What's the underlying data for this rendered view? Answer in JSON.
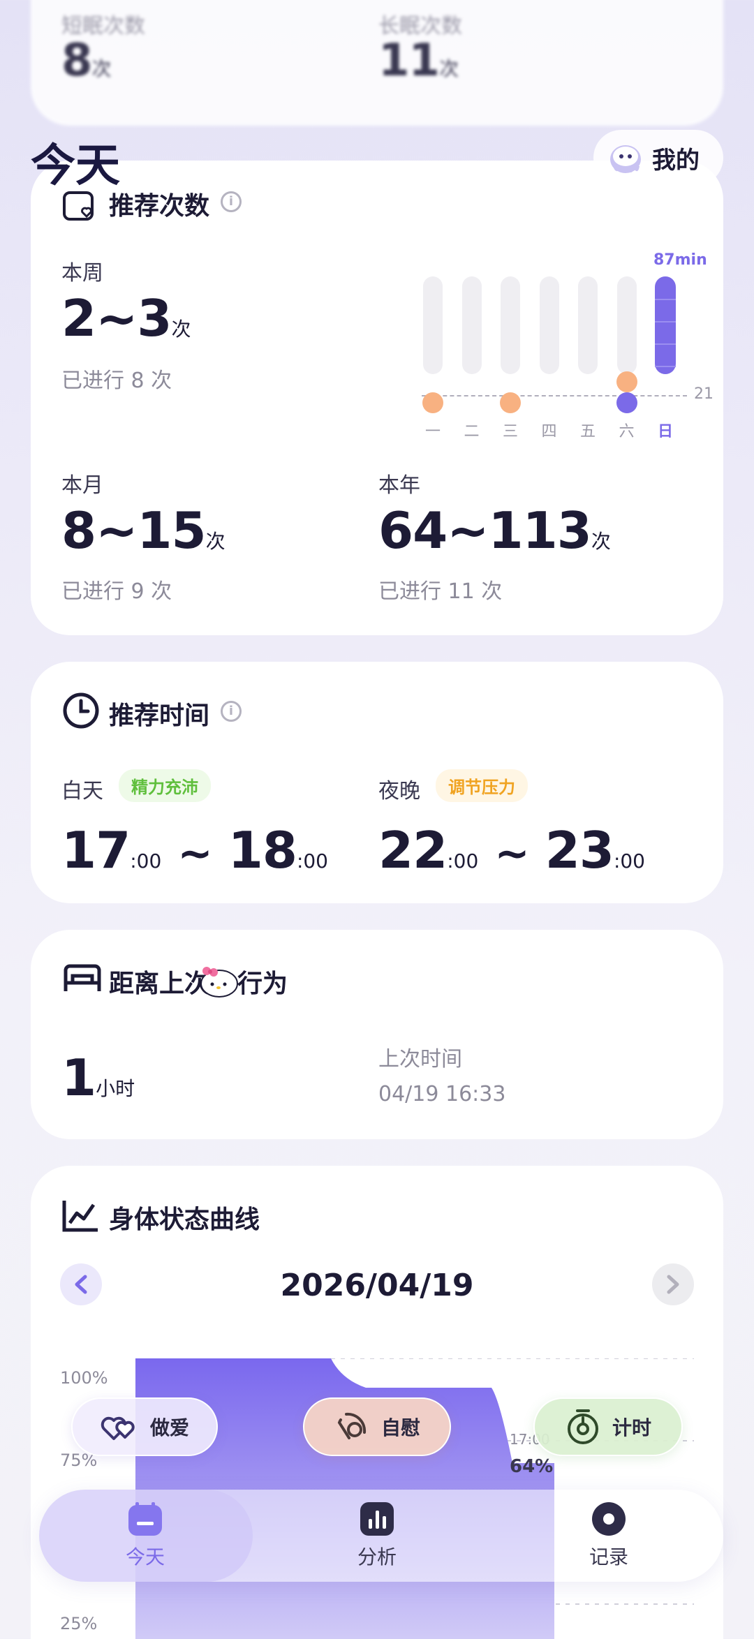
{
  "top_card": {
    "short_label": "短眠次数",
    "short_value": "8",
    "short_unit": "次",
    "long_label": "长眠次数",
    "long_value": "11",
    "long_unit": "次"
  },
  "header": {
    "title": "今天",
    "profile_label": "我的"
  },
  "recommend_count": {
    "title": "推荐次数",
    "week_label": "本周",
    "week_value": "2~3",
    "week_unit": "次",
    "week_done": "已进行 8 次",
    "month_label": "本月",
    "month_value": "8~15",
    "month_unit": "次",
    "month_done": "已进行 9 次",
    "year_label": "本年",
    "year_value": "64~113",
    "year_unit": "次",
    "year_done": "已进行 11 次"
  },
  "chart_data": {
    "type": "bar",
    "categories": [
      "一",
      "二",
      "三",
      "四",
      "五",
      "六",
      "日"
    ],
    "annotation": "87min",
    "reference_line": "21",
    "highlight": "日",
    "orange_dot_days": [
      "一",
      "三",
      "六"
    ],
    "purple_dot_days": [
      "六",
      "日"
    ],
    "colors": {
      "orange": "#f8b181",
      "purple": "#7b6ae8",
      "track": "#efeef2"
    }
  },
  "recommend_time": {
    "title": "推荐时间",
    "day_label": "白天",
    "day_tag": "精力充沛",
    "day_start": "17",
    "day_end": "18",
    "night_label": "夜晚",
    "night_tag": "调节压力",
    "night_start": "22",
    "night_end": "23",
    "minutes": ":00",
    "sep": "~"
  },
  "since_last": {
    "title_part1": "距离上次",
    "title_part2": "行为",
    "value": "1",
    "unit": "小时",
    "last_label": "上次时间",
    "last_time": "04/19 16:33"
  },
  "body_curve": {
    "title": "身体状态曲线",
    "date": "2026/04/19",
    "y_labels": [
      "100%",
      "75%",
      "25%"
    ],
    "marker_time": "17:00",
    "marker_value": "64%"
  },
  "quick_actions": [
    {
      "label": "做爱",
      "icon": "hearts-icon"
    },
    {
      "label": "自慰",
      "icon": "signal-icon"
    },
    {
      "label": "计时",
      "icon": "timer-icon"
    }
  ],
  "nav": [
    {
      "label": "今天",
      "icon": "calendar-icon"
    },
    {
      "label": "分析",
      "icon": "chart-icon"
    },
    {
      "label": "记录",
      "icon": "record-icon"
    }
  ],
  "colors": {
    "accent": "#7b6ae8",
    "orange": "#f8b181",
    "green_tag": "#5fbf3c",
    "yellow_tag": "#f0a321"
  }
}
